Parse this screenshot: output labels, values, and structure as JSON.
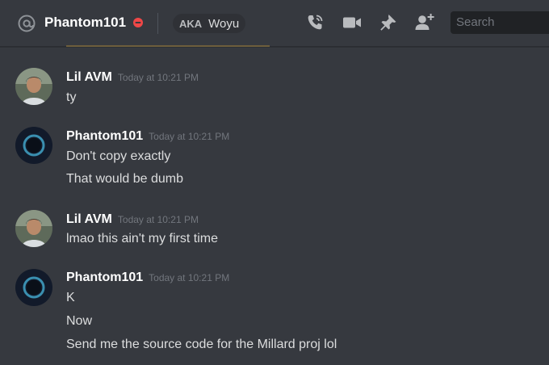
{
  "header": {
    "channel_name": "Phantom101",
    "aka_label": "AKA",
    "aka_value": "Woyu",
    "search_placeholder": "Search",
    "icons": [
      "at-icon",
      "dnd-status-icon",
      "voice-call-icon",
      "video-call-icon",
      "pin-icon",
      "add-friend-icon"
    ]
  },
  "messages": [
    {
      "author": "Lil AVM",
      "timestamp": "Today at 10:21 PM",
      "avatar": "child-photo-avatar",
      "lines": [
        "ty"
      ]
    },
    {
      "author": "Phantom101",
      "timestamp": "Today at 10:21 PM",
      "avatar": "dark-ring-avatar",
      "lines": [
        "Don't copy exactly",
        "That would be dumb"
      ]
    },
    {
      "author": "Lil AVM",
      "timestamp": "Today at 10:21 PM",
      "avatar": "child-photo-avatar",
      "lines": [
        "lmao this ain't my first time"
      ]
    },
    {
      "author": "Phantom101",
      "timestamp": "Today at 10:21 PM",
      "avatar": "dark-ring-avatar",
      "lines": [
        "K",
        "Now",
        "Send me the source code for the Millard proj lol"
      ]
    }
  ],
  "colors": {
    "background": "#36393f",
    "author": "#ffffff",
    "text": "#dcddde",
    "timestamp": "#72767d",
    "dnd_red": "#f04747"
  }
}
